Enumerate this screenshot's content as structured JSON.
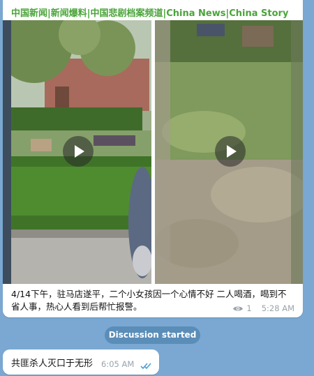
{
  "channel": {
    "title": "中国新闻|新闻爆料|中国悲剧档案频道|China News|China Story",
    "title_color": "#4aa43a"
  },
  "post": {
    "videos": [
      {
        "name": "video-1",
        "icon": "play-icon"
      },
      {
        "name": "video-2",
        "icon": "play-icon"
      }
    ],
    "caption": "4/14下午，驻马店遂平，二个小女孩因一个心情不好 二人喝酒，喝到不省人事，热心人看到后帮忙报警。",
    "views": "1",
    "time": "5:28 AM",
    "view_icon": "eye-icon"
  },
  "service_message": "Discussion started",
  "reply": {
    "text": "共匪杀人灭口于无形",
    "time": "6:05 AM",
    "status_icon": "double-check-icon",
    "status_color": "#4a9ed8"
  },
  "colors": {
    "background": "#7aa8d2",
    "bubble": "#ffffff",
    "pill": "#5a8db8"
  }
}
